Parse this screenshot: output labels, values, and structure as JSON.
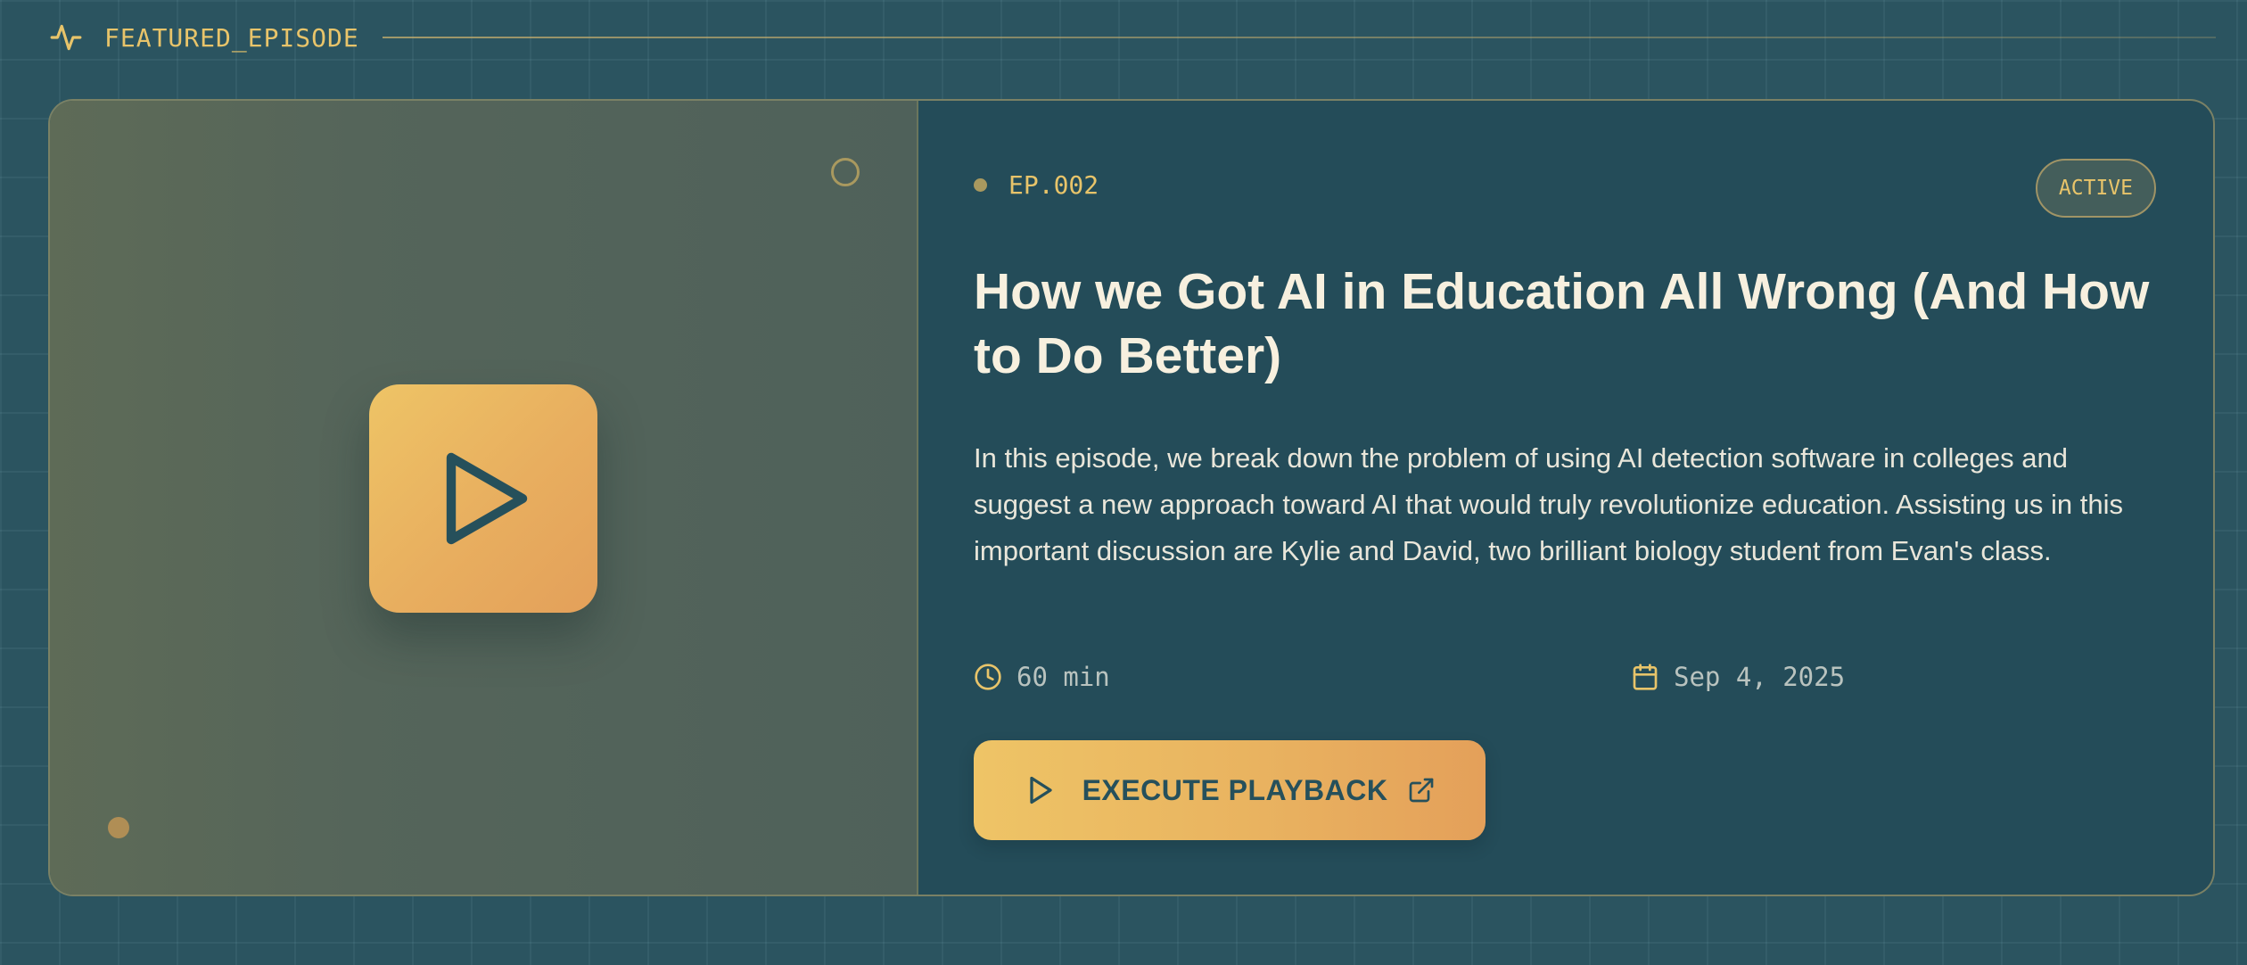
{
  "header": {
    "label": "FEATURED_EPISODE",
    "icon": "activity-pulse-icon"
  },
  "episode": {
    "number": "EP.002",
    "status": "ACTIVE",
    "title": "How we Got AI in Education All Wrong (And How to Do Better)",
    "description": "In this episode, we break down the problem of using AI detection software in colleges and suggest a new approach toward AI that would truly revolutionize education. Assisting us in this important discussion are Kylie and David, two brilliant biology student from Evan's class.",
    "duration": "60 min",
    "date": "Sep 4, 2025"
  },
  "actions": {
    "play_label": "EXECUTE PLAYBACK"
  },
  "colors": {
    "background": "#2b5460",
    "card": "#244c59",
    "accent": "#e8c46a",
    "accent_orange": "#e4a05a",
    "title_text": "#f7f0df",
    "icon_dark": "#26505b"
  },
  "icons": {
    "header": "activity-pulse-icon",
    "thumbnail_play": "play-icon",
    "duration": "clock-icon",
    "date": "calendar-icon",
    "button_play": "play-icon",
    "button_external": "external-link-icon"
  }
}
